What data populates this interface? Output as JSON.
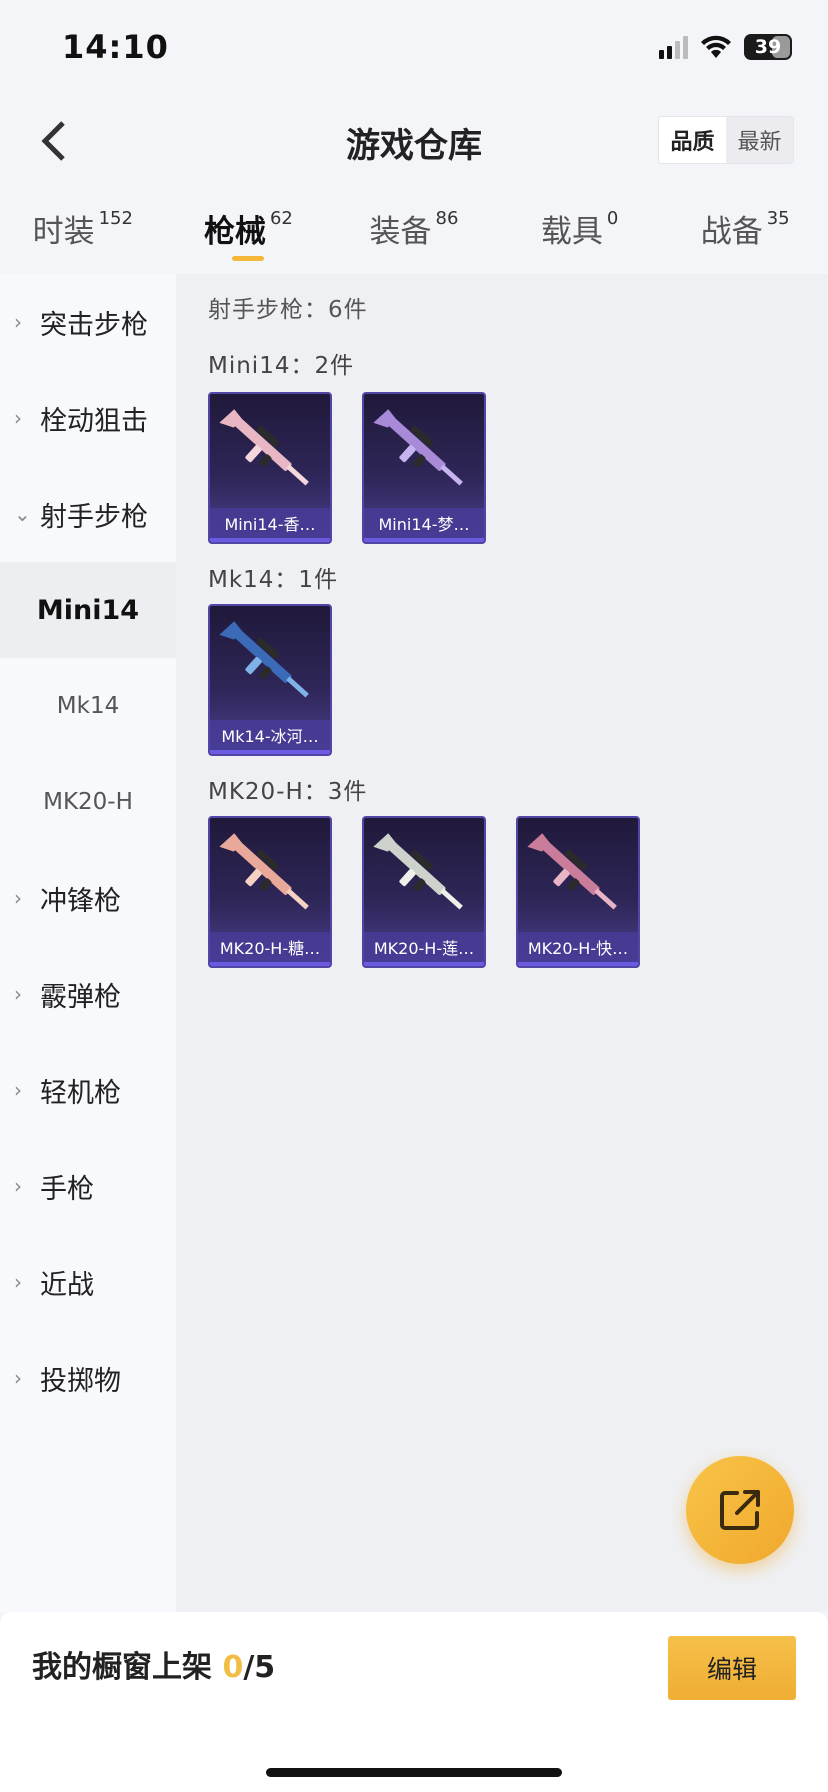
{
  "status_bar": {
    "time": "14:10",
    "battery": "39"
  },
  "header": {
    "title": "游戏仓库",
    "sort_options": [
      "品质",
      "最新"
    ],
    "active_sort": 0
  },
  "tabs": [
    {
      "label": "时装",
      "count": "152"
    },
    {
      "label": "枪械",
      "count": "62"
    },
    {
      "label": "装备",
      "count": "86"
    },
    {
      "label": "载具",
      "count": "0"
    },
    {
      "label": "战备",
      "count": "35"
    }
  ],
  "active_tab": 1,
  "sidebar": {
    "categories": [
      "突击步枪",
      "栓动狙击",
      "射手步枪",
      "冲锋枪",
      "霰弹枪",
      "轻机枪",
      "手枪",
      "近战",
      "投掷物"
    ],
    "expanded_category": "射手步枪",
    "sub_items": [
      "Mini14",
      "Mk14",
      "MK20-H"
    ],
    "active_sub": "Mini14"
  },
  "content": {
    "section_header": "射手步枪：6件",
    "groups": [
      {
        "title": "Mini14：2件",
        "items": [
          {
            "label": "Mini14-香…",
            "gun_color": "#e9b7c4",
            "accent": "#f4d6dd"
          },
          {
            "label": "Mini14-梦…",
            "gun_color": "#a88ad8",
            "accent": "#c7b3ef"
          }
        ]
      },
      {
        "title": "Mk14：1件",
        "items": [
          {
            "label": "Mk14-冰河…",
            "gun_color": "#3a6ab8",
            "accent": "#7fb2e8"
          }
        ]
      },
      {
        "title": "MK20-H：3件",
        "items": [
          {
            "label": "MK20-H-糖…",
            "gun_color": "#e8a89a",
            "accent": "#f5d2c4"
          },
          {
            "label": "MK20-H-莲…",
            "gun_color": "#cdd3cc",
            "accent": "#eef1ea"
          },
          {
            "label": "MK20-H-快…",
            "gun_color": "#c97d9a",
            "accent": "#e9b5c6"
          }
        ]
      }
    ]
  },
  "bottom_bar": {
    "label": "我的橱窗上架",
    "current": "0",
    "total": "/5",
    "edit_label": "编辑"
  },
  "colors": {
    "accent": "#f4b73a",
    "card_bg": "#2e2657"
  },
  "icons": {
    "back": "chevron-left-icon",
    "fab": "share-external-icon"
  }
}
